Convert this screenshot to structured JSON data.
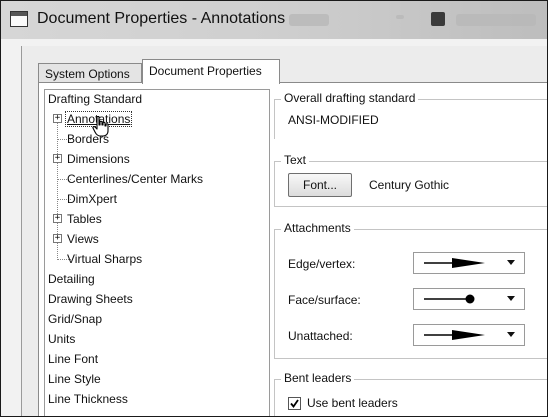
{
  "window": {
    "title": "Document Properties - Annotations"
  },
  "tabs": [
    {
      "label": "System Options",
      "active": false
    },
    {
      "label": "Document Properties",
      "active": true
    }
  ],
  "tree": {
    "items": [
      {
        "label": "Drafting Standard",
        "level": 0,
        "expander": null
      },
      {
        "label": "Annotations",
        "level": 1,
        "expander": "+",
        "selected": true
      },
      {
        "label": "Borders",
        "level": 1,
        "expander": null
      },
      {
        "label": "Dimensions",
        "level": 1,
        "expander": "+"
      },
      {
        "label": "Centerlines/Center Marks",
        "level": 1,
        "expander": null
      },
      {
        "label": "DimXpert",
        "level": 1,
        "expander": null
      },
      {
        "label": "Tables",
        "level": 1,
        "expander": "+"
      },
      {
        "label": "Views",
        "level": 1,
        "expander": "+"
      },
      {
        "label": "Virtual Sharps",
        "level": 1,
        "expander": null
      },
      {
        "label": "Detailing",
        "level": 0,
        "expander": null
      },
      {
        "label": "Drawing Sheets",
        "level": 0,
        "expander": null
      },
      {
        "label": "Grid/Snap",
        "level": 0,
        "expander": null
      },
      {
        "label": "Units",
        "level": 0,
        "expander": null
      },
      {
        "label": "Line Font",
        "level": 0,
        "expander": null
      },
      {
        "label": "Line Style",
        "level": 0,
        "expander": null
      },
      {
        "label": "Line Thickness",
        "level": 0,
        "expander": null
      }
    ]
  },
  "overall": {
    "group_title": "Overall drafting standard",
    "value": "ANSI-MODIFIED"
  },
  "text_group": {
    "group_title": "Text",
    "font_button": "Font...",
    "font_name": "Century Gothic"
  },
  "attachments": {
    "group_title": "Attachments",
    "rows": [
      {
        "label": "Edge/vertex:",
        "icon": "filled-arrow-icon"
      },
      {
        "label": "Face/surface:",
        "icon": "dot-icon"
      },
      {
        "label": "Unattached:",
        "icon": "filled-arrow-icon"
      }
    ]
  },
  "bent_leaders": {
    "group_title": "Bent leaders",
    "checkbox_label": "Use bent leaders",
    "checked": true
  }
}
